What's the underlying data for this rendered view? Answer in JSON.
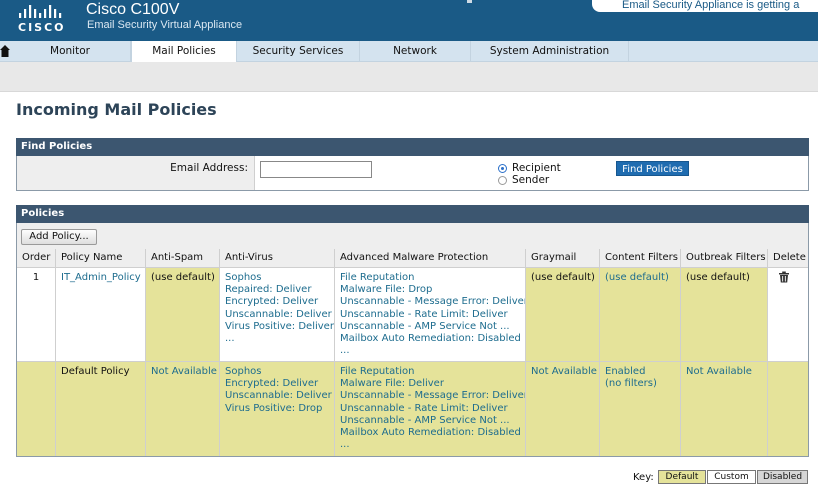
{
  "header": {
    "logo_text": "CISCO",
    "product_title": "Cisco C100V",
    "product_subtitle": "Email Security Virtual Appliance",
    "banner_text": "Email Security Appliance is getting a"
  },
  "nav": {
    "home_icon": "home-icon",
    "tabs": [
      {
        "label": "Monitor"
      },
      {
        "label": "Mail Policies"
      },
      {
        "label": "Security Services"
      },
      {
        "label": "Network"
      },
      {
        "label": "System Administration"
      }
    ],
    "active": "Mail Policies"
  },
  "page": {
    "title": "Incoming Mail Policies"
  },
  "find": {
    "header": "Find Policies",
    "email_label": "Email Address:",
    "email_value": "",
    "radio_recipient": "Recipient",
    "radio_sender": "Sender",
    "selected": "Recipient",
    "button": "Find Policies"
  },
  "policies": {
    "header": "Policies",
    "add_button": "Add Policy...",
    "columns": [
      "Order",
      "Policy Name",
      "Anti-Spam",
      "Anti-Virus",
      "Advanced Malware Protection",
      "Graymail",
      "Content Filters",
      "Outbreak Filters",
      "Delete"
    ],
    "rows": [
      {
        "order": "1",
        "name": "IT_Admin_Policy",
        "anti_spam": "(use default)",
        "anti_virus": [
          "Sophos",
          "Repaired: Deliver",
          "Encrypted: Deliver",
          "Unscannable: Deliver",
          "Virus Positive: Deliver",
          "..."
        ],
        "amp": [
          "File Reputation",
          "Malware File: Drop",
          "Unscannable - Message Error: Deliver",
          "Unscannable - Rate Limit: Deliver",
          "Unscannable - AMP Service Not ...",
          "Mailbox Auto Remediation: Disabled",
          "..."
        ],
        "graymail": "(use default)",
        "content_filters": "(use default)",
        "outbreak_filters": "(use default)",
        "delete_icon": "trash-icon"
      },
      {
        "order": "",
        "name": "Default Policy",
        "anti_spam": "Not Available",
        "anti_virus": [
          "Sophos",
          "Encrypted: Deliver",
          "Unscannable: Deliver",
          "Virus Positive: Drop"
        ],
        "amp": [
          "File Reputation",
          "Malware File: Deliver",
          "Unscannable - Message Error: Deliver",
          "Unscannable - Rate Limit: Deliver",
          "Unscannable - AMP Service Not ...",
          "Mailbox Auto Remediation: Disabled",
          "..."
        ],
        "graymail": "Not Available",
        "content_filters": [
          "Enabled",
          "(no filters)"
        ],
        "outbreak_filters": "Not Available"
      }
    ]
  },
  "key": {
    "label": "Key:",
    "default": "Default",
    "custom": "Custom",
    "disabled": "Disabled"
  },
  "colors": {
    "header_bg": "#1a5a86",
    "panel_head": "#3c5670",
    "default_yellow": "#e5e39a",
    "link": "#1d6c8e",
    "button_blue": "#1f6cb0",
    "disabled_gray": "#d6d6d6"
  }
}
